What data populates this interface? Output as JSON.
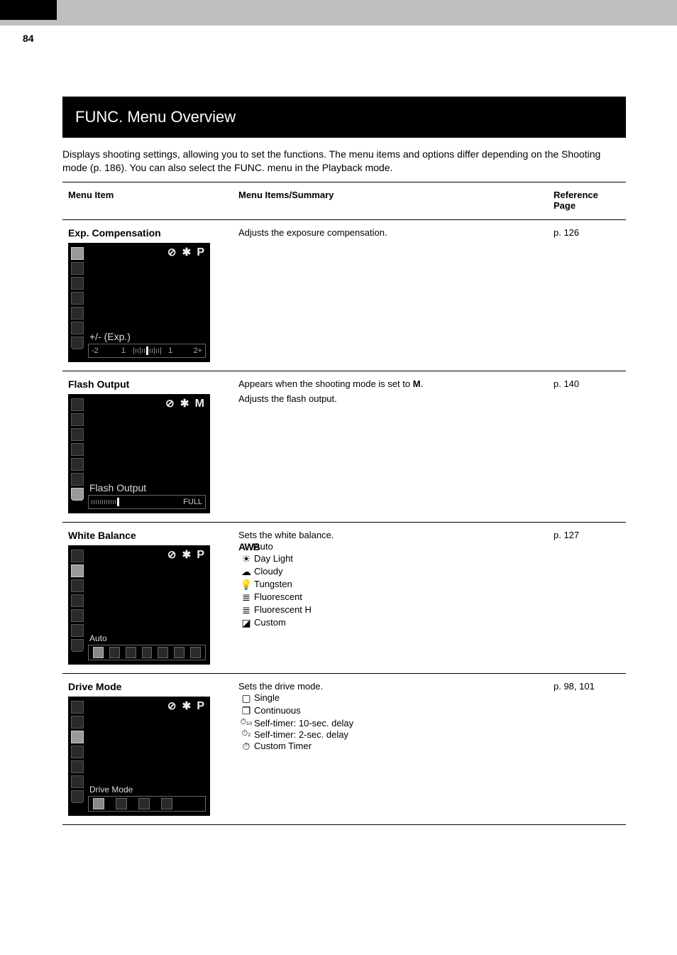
{
  "page_number": "84",
  "title_bar": "FUNC. Menu Overview",
  "intro": "Displays shooting settings, allowing you to set the functions. The menu items and options differ depending on the Shooting mode (p. 186). You can also select the FUNC. menu in the Playback mode.",
  "headers": {
    "item": "Menu Item",
    "desc": "Menu Items/Summary",
    "page": "Reference Page"
  },
  "items": [
    {
      "name": "Exp. Compensation",
      "desc_lines": [
        "Adjusts the exposure compensation."
      ],
      "page_ref": "p. 126",
      "lcd": {
        "mode": "P",
        "label": "+/- (Exp.)",
        "active_index": 0,
        "bottom_type": "exposure"
      }
    },
    {
      "name": "Flash Output",
      "desc_head": "Appears when the shooting mode is set to ",
      "desc_head_bold": "M",
      "desc_head_tail": ".",
      "desc_lines": [
        "Adjusts the flash output."
      ],
      "page_ref": "p. 140",
      "lcd": {
        "mode": "M",
        "label": "Flash Output",
        "active_index": 6,
        "bottom_type": "flash"
      }
    },
    {
      "name": "White Balance",
      "desc_lines": [
        "Sets the white balance."
      ],
      "options": [
        {
          "icon": "AWB",
          "label": "Auto"
        },
        {
          "icon": "sun",
          "label": "Day Light"
        },
        {
          "icon": "cloud",
          "label": "Cloudy"
        },
        {
          "icon": "bulb",
          "label": "Tungsten"
        },
        {
          "icon": "fl1",
          "label": "Fluorescent"
        },
        {
          "icon": "fl2",
          "label": "Fluorescent H"
        },
        {
          "icon": "cust",
          "label": "Custom"
        }
      ],
      "page_ref": "p. 127",
      "lcd": {
        "mode": "P",
        "label": "Auto",
        "active_index": 1,
        "bottom_type": "wb"
      }
    },
    {
      "name": "Drive Mode",
      "desc_lines": [
        "Sets the drive mode."
      ],
      "options": [
        {
          "icon": "single",
          "label": "Single"
        },
        {
          "icon": "cont",
          "label": "Continuous"
        },
        {
          "icon": "t10",
          "label": "Self-timer: 10-sec. delay"
        },
        {
          "icon": "t2",
          "label": "Self-timer: 2-sec. delay"
        },
        {
          "icon": "tcust",
          "label": "Custom Timer"
        }
      ],
      "page_ref": "p. 98, 101",
      "lcd": {
        "mode": "P",
        "label": "Drive Mode",
        "active_index": 2,
        "bottom_type": "drive"
      }
    }
  ],
  "lcd_flash_full": "FULL"
}
